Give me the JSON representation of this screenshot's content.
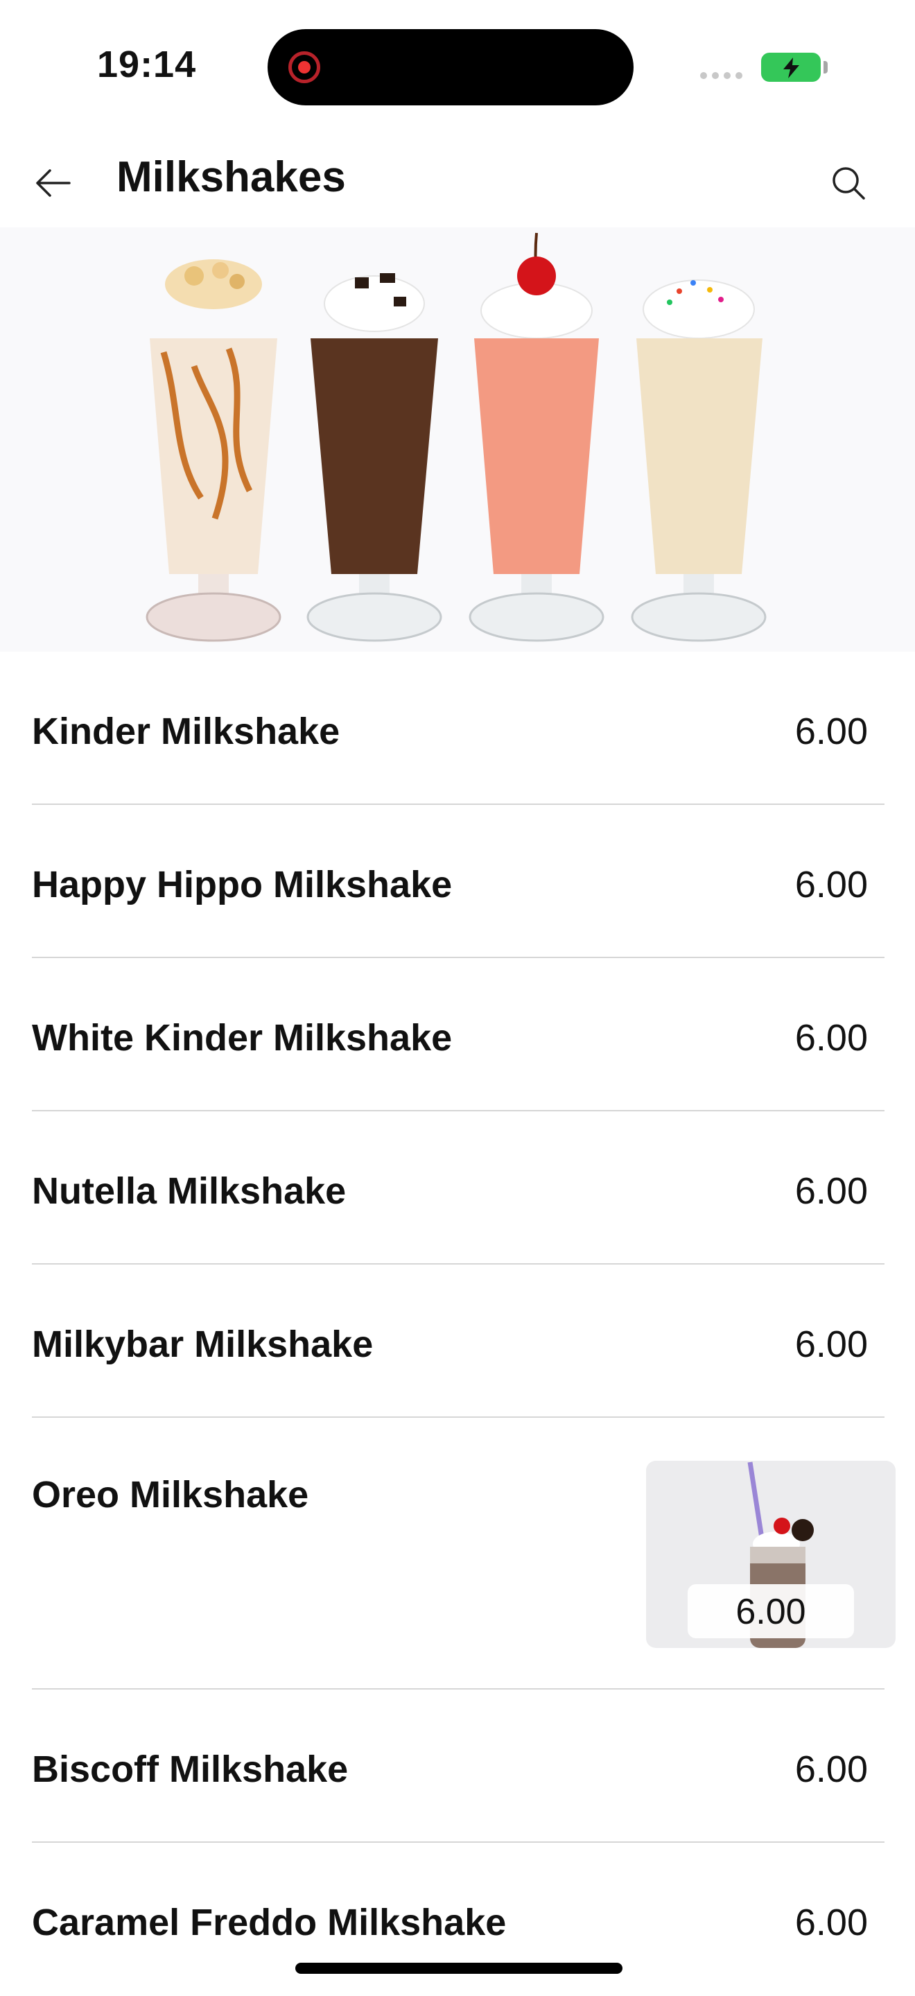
{
  "status_bar": {
    "time": "19:14"
  },
  "header": {
    "title": "Milkshakes"
  },
  "items": [
    {
      "name": "Kinder Milkshake",
      "price": "6.00"
    },
    {
      "name": "Happy Hippo Milkshake",
      "price": "6.00"
    },
    {
      "name": "White Kinder Milkshake",
      "price": "6.00"
    },
    {
      "name": "Nutella Milkshake",
      "price": "6.00"
    },
    {
      "name": "Milkybar Milkshake",
      "price": "6.00"
    },
    {
      "name": "Oreo Milkshake",
      "price": "6.00"
    },
    {
      "name": "Biscoff Milkshake",
      "price": "6.00"
    },
    {
      "name": "Caramel Freddo Milkshake",
      "price": "6.00"
    }
  ],
  "icons": {
    "back": "arrow-left-icon",
    "search": "magnifier-icon",
    "record": "screen-recording-icon",
    "battery": "battery-charging-icon"
  },
  "colors": {
    "background": "#ffffff",
    "text": "#111111",
    "divider": "#d6d6d6",
    "battery": "#34c759"
  }
}
